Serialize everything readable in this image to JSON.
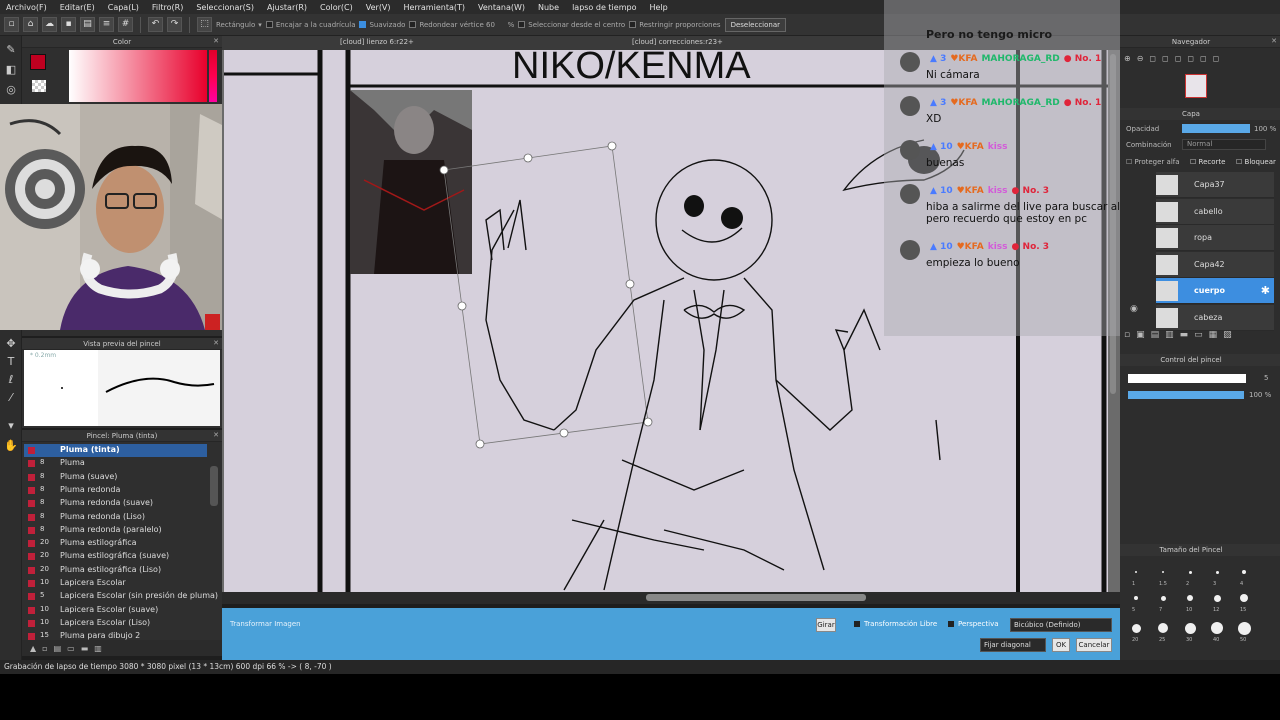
{
  "menu": [
    "Archivo(F)",
    "Editar(E)",
    "Capa(L)",
    "Filtro(R)",
    "Seleccionar(S)",
    "Ajustar(R)",
    "Color(C)",
    "Ver(V)",
    "Herramienta(T)",
    "Ventana(W)",
    "Nube",
    "lapso de tiempo",
    "Help"
  ],
  "toolbar": {
    "shape": "Rectángulo",
    "snap": "Encajar a la cuadrícula",
    "smooth": "Suavizado",
    "round": "Redondear vértice 60",
    "round_pct": "%",
    "from_center": "Seleccionar desde el centro",
    "constrain": "Restringir proporciones",
    "deselect": "Deseleccionar"
  },
  "panels": {
    "color_title": "Color",
    "brush_preview_title": "Vista previa del pincel",
    "brush_preview_size": "* 0.2mm",
    "brush_list_title": "Pincel: Pluma (tinta)",
    "navigator_title": "Navegador",
    "layer_title": "Capa",
    "opacity_label": "Opacidad",
    "opacity_value": "100 %",
    "blend_label": "Combinación",
    "blend_value": "Normal",
    "protect_alpha": "Proteger alfa",
    "clip": "Recorte",
    "lock": "Bloquear",
    "brush_control_title": "Control del pincel",
    "brush_control_size": "5",
    "brush_control_opacity": "100 %",
    "brush_size_title": "Tamaño del Pincel"
  },
  "brushes": [
    {
      "size": "",
      "name": "Pluma (tinta)",
      "selected": true
    },
    {
      "size": "8",
      "name": "Pluma"
    },
    {
      "size": "8",
      "name": "Pluma (suave)"
    },
    {
      "size": "8",
      "name": "Pluma redonda"
    },
    {
      "size": "8",
      "name": "Pluma redonda (suave)"
    },
    {
      "size": "8",
      "name": "Pluma redonda (Liso)"
    },
    {
      "size": "8",
      "name": "Pluma redonda (paralelo)"
    },
    {
      "size": "20",
      "name": "Pluma estilográfica"
    },
    {
      "size": "20",
      "name": "Pluma estilográfica (suave)"
    },
    {
      "size": "20",
      "name": "Pluma estilográfica (Liso)"
    },
    {
      "size": "10",
      "name": "Lapicera Escolar"
    },
    {
      "size": "5",
      "name": "Lapicera Escolar (sin presión de pluma)"
    },
    {
      "size": "10",
      "name": "Lapicera Escolar (suave)"
    },
    {
      "size": "10",
      "name": "Lapicera Escolar (Liso)"
    },
    {
      "size": "15",
      "name": "Pluma para dibujo 2"
    }
  ],
  "canvas_tabs": [
    "[cloud] lienzo 6:r22+",
    "[cloud] correcciones:r23+"
  ],
  "canvas_title": "NIKO/KENMA",
  "chat": {
    "top_line": "Pero no tengo micro",
    "messages": [
      {
        "level": "3",
        "badge": "KFA",
        "user": "MAHORAGA_RD",
        "rank": "No. 1",
        "text": "Ni cámara"
      },
      {
        "level": "3",
        "badge": "KFA",
        "user": "MAHORAGA_RD",
        "rank": "No. 1",
        "text": "XD"
      },
      {
        "level": "10",
        "badge": "KFA",
        "user": "kiss",
        "rank": "",
        "text": "buenas"
      },
      {
        "level": "10",
        "badge": "KFA",
        "user": "kiss",
        "rank": "No. 3",
        "text": "hiba a salirme del live para buscar algo",
        "text2": "pero recuerdo que estoy en pc"
      },
      {
        "level": "10",
        "badge": "KFA",
        "user": "kiss",
        "rank": "No. 3",
        "text": "empieza lo bueno"
      }
    ]
  },
  "layers": [
    {
      "name": "Capa37"
    },
    {
      "name": "cabello"
    },
    {
      "name": "ropa"
    },
    {
      "name": "Capa42"
    },
    {
      "name": "cuerpo",
      "selected": true
    },
    {
      "name": "cabeza"
    }
  ],
  "brush_sizes": [
    [
      "1",
      "1.5",
      "2",
      "3",
      "4"
    ],
    [
      "5",
      "7",
      "10",
      "12",
      "15"
    ],
    [
      "20",
      "25",
      "30",
      "40",
      "50"
    ]
  ],
  "transform": {
    "label": "Transformar Imagen",
    "rotate": "Girar",
    "free": "Transformación Libre",
    "perspective": "Perspectiva",
    "interp": "Bicúbico (Definido)",
    "fix": "Fijar diagonal",
    "ok": "OK",
    "cancel": "Cancelar"
  },
  "status": "Grabación de lapso de tiempo  3080 * 3080 pixel  (13 * 13cm)  600 dpi  66 %  -> ( 8, -70 )",
  "colors": {
    "accent": "#4aa1d9",
    "selected_row": "#2d5fa0",
    "paper": "#d6d0dc",
    "fg_color": "#c00020"
  }
}
